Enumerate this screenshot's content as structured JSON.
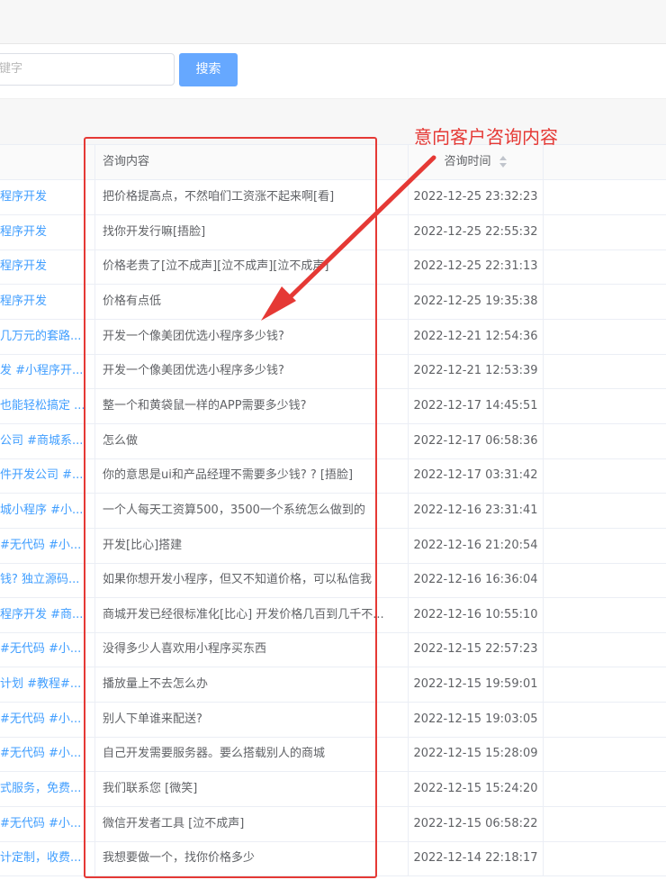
{
  "search": {
    "placeholder_fragment": "键字",
    "button_label": "搜索"
  },
  "table": {
    "headers": {
      "content": "咨询内容",
      "time": "咨询时间"
    },
    "rows": [
      {
        "title": "程序开发",
        "content": "把价格提高点，不然咱们工资涨不起来啊[看]",
        "time": "2022-12-25 23:32:23"
      },
      {
        "title": "程序开发",
        "content": "找你开发行嘛[捂脸]",
        "time": "2022-12-25 22:55:32"
      },
      {
        "title": "程序开发",
        "content": "价格老贵了[泣不成声][泣不成声][泣不成声]",
        "time": "2022-12-25 22:31:13"
      },
      {
        "title": "程序开发",
        "content": "价格有点低",
        "time": "2022-12-25 19:35:38"
      },
      {
        "title": "几万元的套路...",
        "content": "开发一个像美团优选小程序多少钱?",
        "time": "2022-12-21 12:54:36"
      },
      {
        "title": "发 #小程序开...",
        "content": "开发一个像美团优选小程序多少钱?",
        "time": "2022-12-21 12:53:39"
      },
      {
        "title": "也能轻松搞定 ...",
        "content": "整一个和黄袋鼠一样的APP需要多少钱?",
        "time": "2022-12-17 14:45:51"
      },
      {
        "title": "公司 #商城系...",
        "content": "怎么做",
        "time": "2022-12-17 06:58:36"
      },
      {
        "title": "件开发公司 #...",
        "content": "你的意思是ui和产品经理不需要多少钱? ? [捂脸]",
        "time": "2022-12-17 03:31:42"
      },
      {
        "title": "城小程序 #小...",
        "content": "一个人每天工资算500，3500一个系统怎么做到的",
        "time": "2022-12-16 23:31:41"
      },
      {
        "title": "#无代码 #小...",
        "content": "开发[比心]搭建",
        "time": "2022-12-16 21:20:54"
      },
      {
        "title": "钱? 独立源码...",
        "content": "如果你想开发小程序，但又不知道价格，可以私信我",
        "time": "2022-12-16 16:36:04"
      },
      {
        "title": "程序开发 #商...",
        "content": "商城开发已经很标准化[比心] 开发价格几百到几千不...",
        "time": "2022-12-16 10:55:10"
      },
      {
        "title": "#无代码 #小...",
        "content": "没得多少人喜欢用小程序买东西",
        "time": "2022-12-15 22:57:23"
      },
      {
        "title": "计划 #教程#...",
        "content": "播放量上不去怎么办",
        "time": "2022-12-15 19:59:01"
      },
      {
        "title": "#无代码 #小...",
        "content": "别人下单谁来配送?",
        "time": "2022-12-15 19:03:05"
      },
      {
        "title": "#无代码 #小...",
        "content": "自己开发需要服务器。要么搭载别人的商城",
        "time": "2022-12-15 15:28:09"
      },
      {
        "title": "式服务，免费...",
        "content": "我们联系您 [微笑]",
        "time": "2022-12-15 15:24:20"
      },
      {
        "title": "#无代码 #小...",
        "content": "微信开发者工具 [泣不成声]",
        "time": "2022-12-15 06:58:22"
      },
      {
        "title": "计定制，收费...",
        "content": "我想要做一个，找你价格多少",
        "time": "2022-12-14 22:18:17"
      }
    ]
  },
  "annotation": {
    "text": "意向客户咨询内容",
    "color": "#e53935"
  },
  "colors": {
    "link": "#409eff",
    "button": "#66a8ff",
    "highlight": "#e53935"
  }
}
